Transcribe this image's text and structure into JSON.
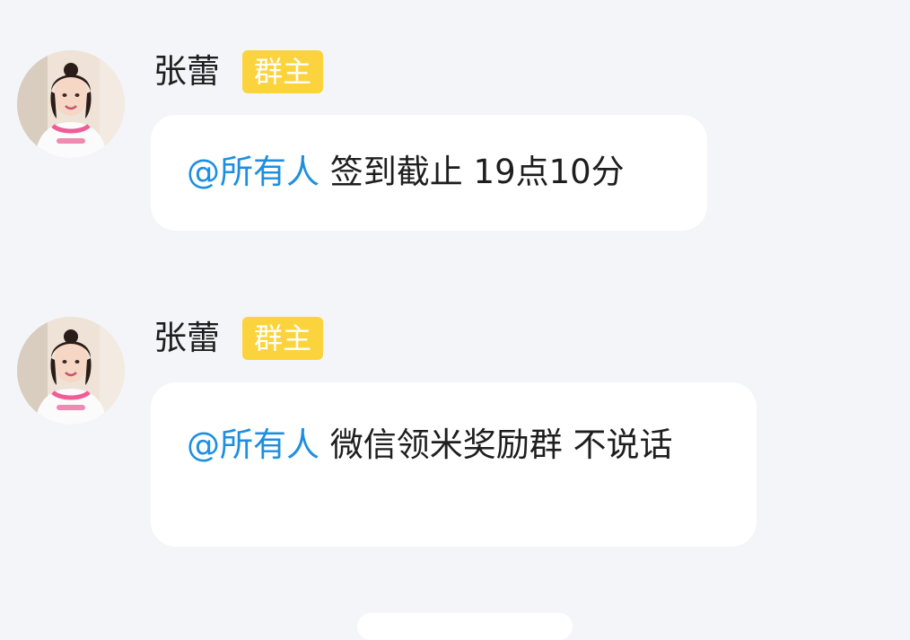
{
  "messages": [
    {
      "sender": "张蕾",
      "role_badge": "群主",
      "mention": "@所有人",
      "text": " 签到截止 19点10分"
    },
    {
      "sender": "张蕾",
      "role_badge": "群主",
      "mention": "@所有人",
      "text": " 微信领米奖励群 不说话"
    }
  ],
  "colors": {
    "background": "#f4f5f9",
    "bubble": "#ffffff",
    "mention": "#1e8fe0",
    "badge": "#fbd33d"
  },
  "icons": {
    "avatar": "user-photo-avatar"
  }
}
